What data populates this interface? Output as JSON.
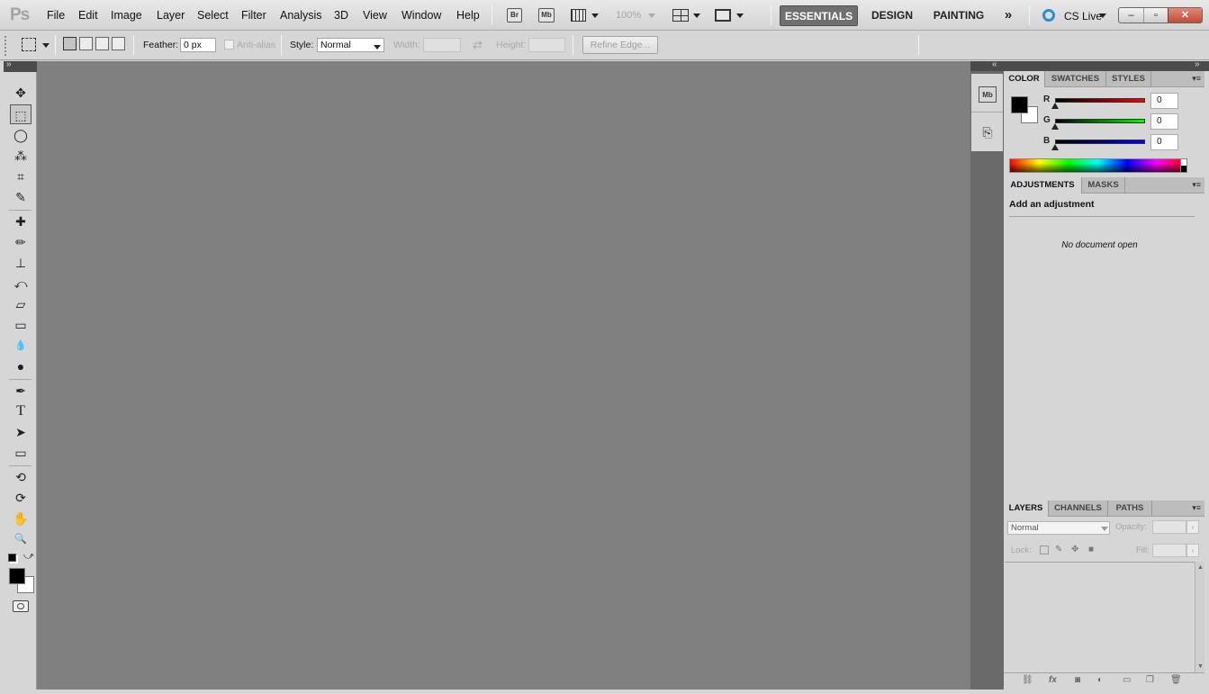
{
  "app": {
    "logo": "Ps",
    "menu": [
      "File",
      "Edit",
      "Image",
      "Layer",
      "Select",
      "Filter",
      "Analysis",
      "3D",
      "View",
      "Window",
      "Help"
    ],
    "launch_bridge": "Br",
    "launch_minibridge": "Mb",
    "zoom": "100%",
    "workspaces": [
      "ESSENTIALS",
      "DESIGN",
      "PAINTING"
    ],
    "active_workspace": "ESSENTIALS",
    "more_workspaces": "»",
    "cs_live": "CS Live",
    "window_controls": {
      "minimize": "–",
      "restore": "▫",
      "close": "✕"
    }
  },
  "options_bar": {
    "feather_label": "Feather:",
    "feather_value": "0 px",
    "antialias_label": "Anti-alias",
    "style_label": "Style:",
    "style_value": "Normal",
    "width_label": "Width:",
    "height_label": "Height:",
    "swap_glyph": "⇄",
    "refine_edge": "Refine Edge..."
  },
  "tools": [
    {
      "name": "move-tool",
      "glyph": "✥"
    },
    {
      "name": "rectangular-marquee-tool",
      "glyph": "⬚",
      "selected": true
    },
    {
      "name": "lasso-tool",
      "glyph": "◯"
    },
    {
      "name": "quick-selection-tool",
      "glyph": "⁂"
    },
    {
      "name": "crop-tool",
      "glyph": "⌗"
    },
    {
      "name": "eyedropper-tool",
      "glyph": "✎"
    },
    {
      "name": "spot-healing-tool",
      "glyph": "✚"
    },
    {
      "name": "brush-tool",
      "glyph": "✏"
    },
    {
      "name": "clone-stamp-tool",
      "glyph": "⊥"
    },
    {
      "name": "history-brush-tool",
      "glyph": "⤺"
    },
    {
      "name": "eraser-tool",
      "glyph": "▱"
    },
    {
      "name": "gradient-tool",
      "glyph": "▭"
    },
    {
      "name": "blur-tool",
      "glyph": "💧"
    },
    {
      "name": "dodge-tool",
      "glyph": "●"
    },
    {
      "name": "pen-tool",
      "glyph": "✒"
    },
    {
      "name": "type-tool",
      "glyph": "T"
    },
    {
      "name": "path-selection-tool",
      "glyph": "➤"
    },
    {
      "name": "rectangle-shape-tool",
      "glyph": "▭"
    },
    {
      "name": "3d-rotate-tool",
      "glyph": "⟲"
    },
    {
      "name": "3d-orbit-tool",
      "glyph": "⟳"
    },
    {
      "name": "hand-tool",
      "glyph": "✋"
    },
    {
      "name": "zoom-tool",
      "glyph": "🔍"
    }
  ],
  "colors": {
    "foreground": "#000000",
    "background": "#ffffff",
    "canvas": "#808080",
    "active_workspace_bg": "#6f6f6f",
    "cs_live_accent": "#2a8fd0"
  },
  "color_panel": {
    "tabs": [
      "COLOR",
      "SWATCHES",
      "STYLES"
    ],
    "active_tab": "COLOR",
    "channels": [
      {
        "label": "R",
        "value": "0",
        "gradient": "#ff0000"
      },
      {
        "label": "G",
        "value": "0",
        "gradient": "#00ff00"
      },
      {
        "label": "B",
        "value": "0",
        "gradient": "#0000ff"
      }
    ]
  },
  "adjustments_panel": {
    "tabs": [
      "ADJUSTMENTS",
      "MASKS"
    ],
    "active_tab": "ADJUSTMENTS",
    "title": "Add an adjustment",
    "empty_message": "No document open"
  },
  "layers_panel": {
    "tabs": [
      "LAYERS",
      "CHANNELS",
      "PATHS"
    ],
    "active_tab": "LAYERS",
    "blend_mode": "Normal",
    "opacity_label": "Opacity:",
    "lock_label": "Lock:",
    "fill_label": "Fill:",
    "footer_icons": [
      "link-layers-icon",
      "fx-icon",
      "add-mask-icon",
      "adjustment-layer-icon",
      "new-group-icon",
      "new-layer-icon",
      "delete-layer-icon"
    ]
  },
  "panel_menu_glyph": "▾≡",
  "collapse_glyph": "«",
  "expand_glyph": "»"
}
